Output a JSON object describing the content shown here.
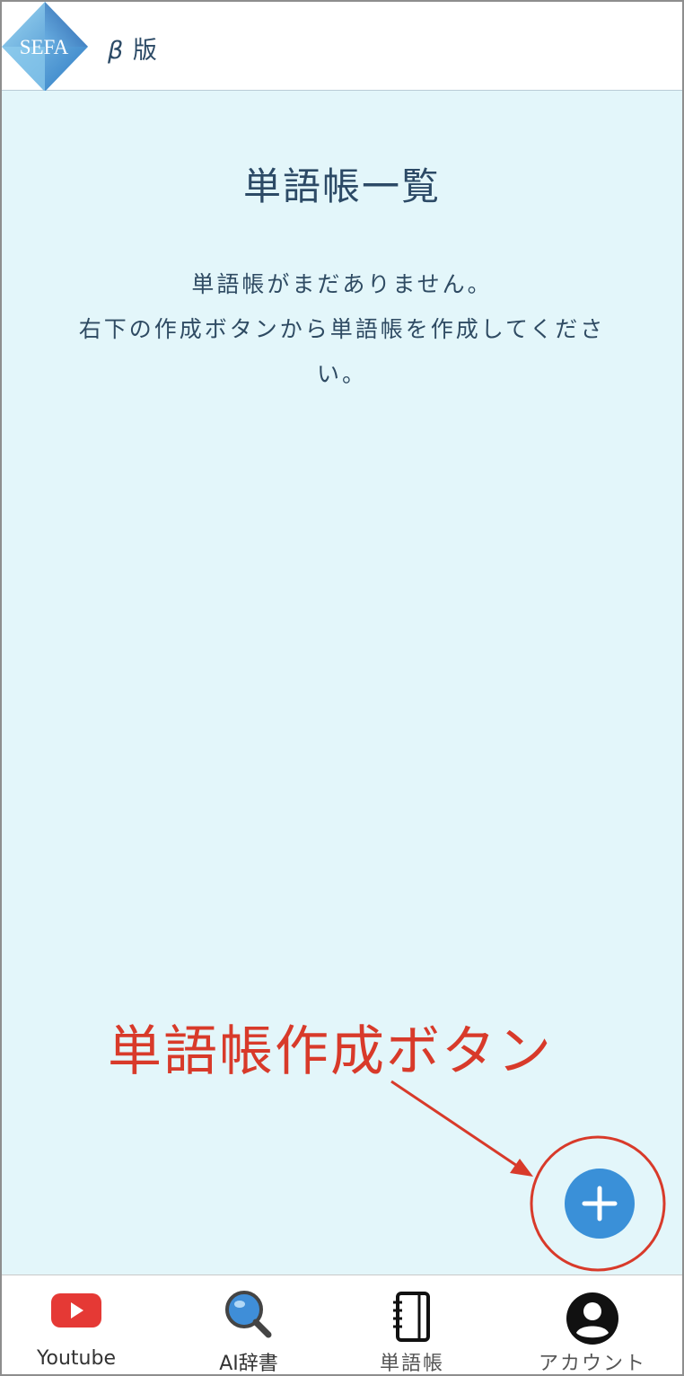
{
  "header": {
    "logo_text": "SEFA",
    "beta_symbol": "β",
    "beta_label": "版"
  },
  "main": {
    "title": "単語帳一覧",
    "empty_line1": "単語帳がまだありません。",
    "empty_line2": "右下の作成ボタンから単語帳を作成してくださ",
    "empty_line3": "い。"
  },
  "annotation": {
    "label": "単語帳作成ボタン",
    "color": "#d83a2a"
  },
  "fab": {
    "icon": "plus-icon",
    "color": "#3a90d8"
  },
  "nav": {
    "items": [
      {
        "label": "Youtube",
        "icon": "youtube-icon"
      },
      {
        "label": "AI辞書",
        "icon": "search-icon"
      },
      {
        "label": "単語帳",
        "icon": "notebook-icon"
      },
      {
        "label": "アカウント",
        "icon": "account-icon"
      }
    ]
  }
}
